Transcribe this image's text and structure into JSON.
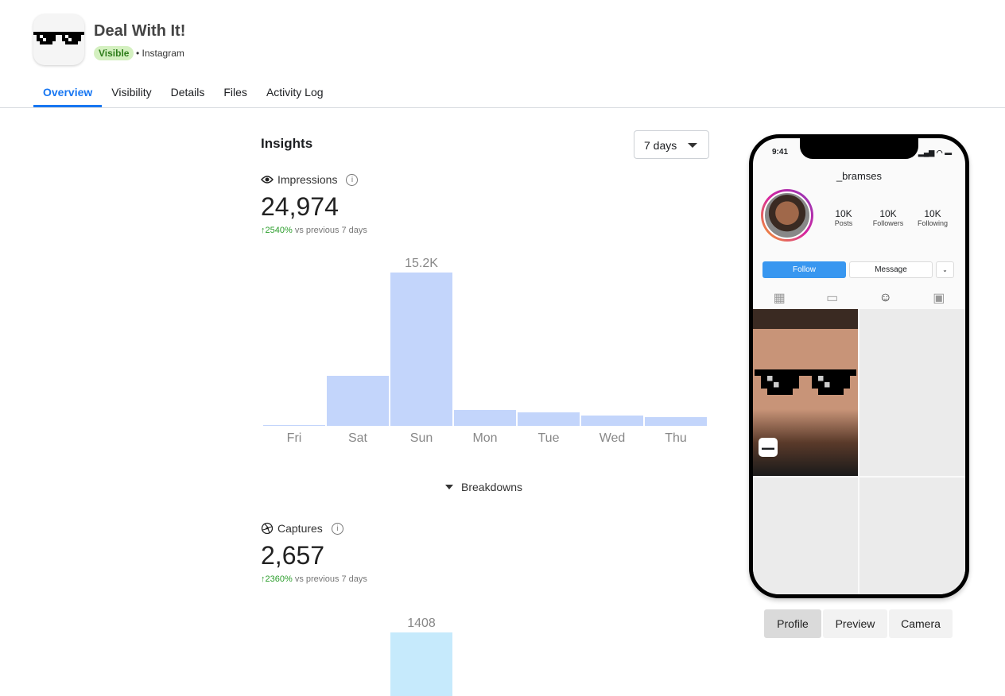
{
  "app": {
    "title": "Deal With It!",
    "status": "Visible",
    "platform": "• Instagram",
    "icon": "pixel-sunglasses-icon"
  },
  "tabs": [
    {
      "label": "Overview",
      "active": true
    },
    {
      "label": "Visibility"
    },
    {
      "label": "Details"
    },
    {
      "label": "Files"
    },
    {
      "label": "Activity Log"
    }
  ],
  "insights": {
    "title": "Insights",
    "range": "7 days",
    "breakdowns": "Breakdowns"
  },
  "impressions": {
    "label": "Impressions",
    "value": "24,974",
    "delta": "2540%",
    "delta_text": " vs previous 7 days"
  },
  "captures": {
    "label": "Captures",
    "value": "2,657",
    "delta": "2360%",
    "delta_text": " vs previous 7 days"
  },
  "chart_data": [
    {
      "type": "bar",
      "categories": [
        "Fri",
        "Sat",
        "Sun",
        "Mon",
        "Tue",
        "Wed",
        "Thu"
      ],
      "values": [
        100,
        5000,
        15200,
        1600,
        1350,
        1000,
        870
      ],
      "data_labels": {
        "Sun": "15.2K"
      },
      "color": "#c3d5fb",
      "grid": false
    },
    {
      "type": "bar",
      "categories": [
        "Sun"
      ],
      "values": [
        1408
      ],
      "data_labels": {
        "Sun": "1408"
      },
      "color": "#c6eafc",
      "grid": false
    }
  ],
  "phone": {
    "time": "9:41",
    "username": "_bramses",
    "stats": [
      {
        "value": "10K",
        "label": "Posts"
      },
      {
        "value": "10K",
        "label": "Followers"
      },
      {
        "value": "10K",
        "label": "Following"
      }
    ],
    "follow": "Follow",
    "message": "Message",
    "accent": "#3897f0"
  },
  "preview_tabs": [
    {
      "label": "Profile",
      "active": true
    },
    {
      "label": "Preview"
    },
    {
      "label": "Camera"
    }
  ]
}
